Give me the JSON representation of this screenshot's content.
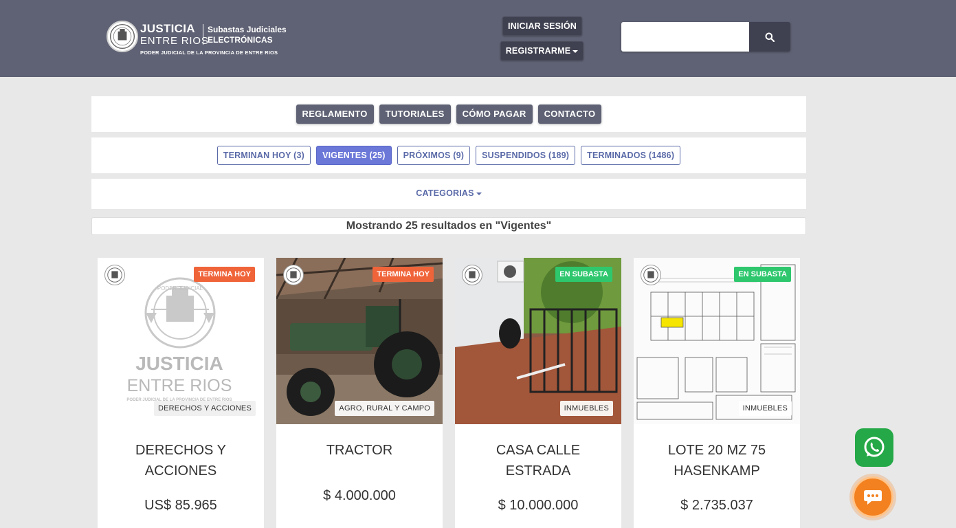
{
  "header": {
    "logo_line1": "JUSTICIA",
    "logo_line2": "ENTRE RIOS",
    "logo_sub1": "Subastas Judiciales",
    "logo_sub2": "ELECTRÓNICAS",
    "logo_foot": "PODER JUDICIAL DE LA PROVINCIA DE ENTRE RIOS",
    "login_label": "INICIAR SESIÓN",
    "register_label": "REGISTRARME",
    "search_placeholder": "",
    "search_value": ""
  },
  "nav": [
    {
      "label": "REGLAMENTO"
    },
    {
      "label": "TUTORIALES"
    },
    {
      "label": "CÓMO PAGAR"
    },
    {
      "label": "CONTACTO"
    }
  ],
  "filters": [
    {
      "label": "TERMINAN HOY (3)",
      "active": false
    },
    {
      "label": "VIGENTES (25)",
      "active": true
    },
    {
      "label": "PRÓXIMOS (9)",
      "active": false
    },
    {
      "label": "SUSPENDIDOS (189)",
      "active": false
    },
    {
      "label": "TERMINADOS (1486)",
      "active": false
    }
  ],
  "categories_label": "CATEGORIAS",
  "results_text": "Mostrando 25 resultados en \"Vigentes\"",
  "placeholder_logo": {
    "arc_text": "PODER JUDICIAL",
    "line1": "JUSTICIA",
    "line2": "ENTRE RIOS",
    "foot": "PODER JUDICIAL DE LA PROVINCIA DE ENTRE RIOS"
  },
  "colors": {
    "header_bg": "#5f6274",
    "accent": "#6b78d8",
    "termina_hoy": "#f0643a",
    "en_subasta": "#2ec76e",
    "whatsapp": "#25a847",
    "chat": "#f3811f"
  },
  "cards": [
    {
      "status": "TERMINA HOY",
      "category": "DERECHOS Y ACCIONES",
      "title": "DERECHOS Y ACCIONES",
      "price": "US$ 85.965"
    },
    {
      "status": "TERMINA HOY",
      "category": "AGRO, RURAL Y CAMPO",
      "title": "TRACTOR",
      "price": "$ 4.000.000"
    },
    {
      "status": "EN SUBASTA",
      "category": "INMUEBLES",
      "title": "CASA CALLE ESTRADA",
      "price": "$ 10.000.000"
    },
    {
      "status": "EN SUBASTA",
      "category": "INMUEBLES",
      "title": "LOTE 20 MZ 75 HASENKAMP",
      "price": "$ 2.735.037"
    }
  ]
}
